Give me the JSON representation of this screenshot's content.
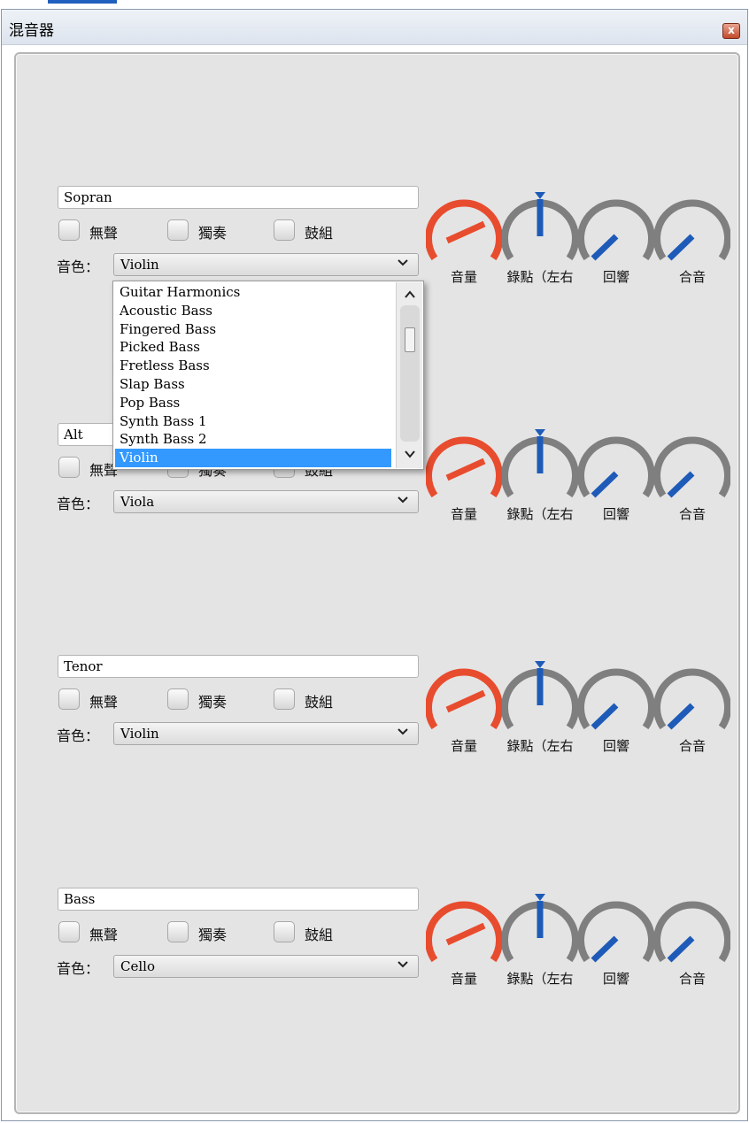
{
  "window": {
    "title": "混音器",
    "close_label": "x"
  },
  "labels": {
    "mute": "無聲",
    "solo": "獨奏",
    "drums": "鼓組",
    "tone": "音色："
  },
  "knob_labels": {
    "volume": "音量",
    "pan": "錄點（左右",
    "reverb": "回響",
    "chorus": "合音"
  },
  "colors": {
    "volume_arc": "#e84c2e",
    "knob_track": "#7f7f7f",
    "indicator": "#1e5bb8",
    "selection": "#3399ff"
  },
  "tracks": [
    {
      "name": "Sopran",
      "instrument": "Violin",
      "mute": false,
      "solo": false,
      "drums": false
    },
    {
      "name": "Alt",
      "instrument": "Viola",
      "mute": false,
      "solo": false,
      "drums": false
    },
    {
      "name": "Tenor",
      "instrument": "Violin",
      "mute": false,
      "solo": false,
      "drums": false
    },
    {
      "name": "Bass",
      "instrument": "Cello",
      "mute": false,
      "solo": false,
      "drums": false
    }
  ],
  "dropdown": {
    "items": [
      "Guitar Harmonics",
      "Acoustic Bass",
      "Fingered Bass",
      "Picked Bass",
      "Fretless Bass",
      "Slap Bass",
      "Pop Bass",
      "Synth Bass 1",
      "Synth Bass 2",
      "Violin"
    ],
    "selected": "Violin"
  }
}
